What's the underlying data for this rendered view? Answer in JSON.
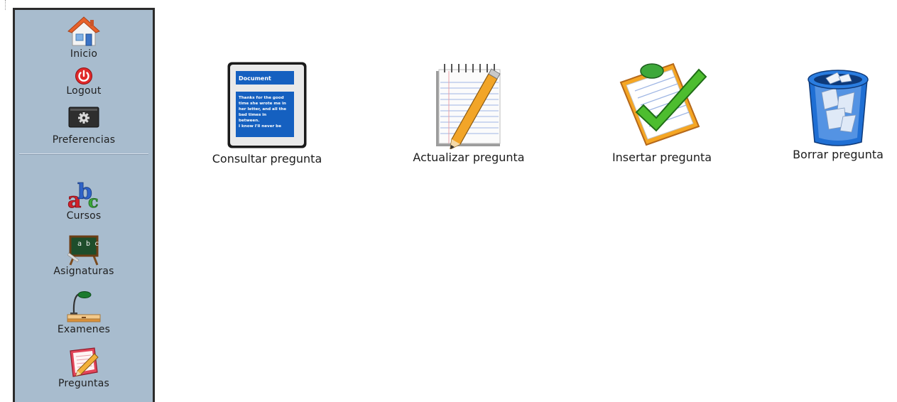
{
  "sidebar": {
    "top_items": [
      {
        "label": "Inicio",
        "icon": "home-icon"
      },
      {
        "label": "Logout",
        "icon": "power-icon"
      },
      {
        "label": "Preferencias",
        "icon": "gear-icon"
      }
    ],
    "items": [
      {
        "label": "Cursos",
        "icon": "abc-icon"
      },
      {
        "label": "Asignaturas",
        "icon": "chalkboard-icon"
      },
      {
        "label": "Examenes",
        "icon": "desk-lamp-icon"
      },
      {
        "label": "Preguntas",
        "icon": "notepad-pencil-icon"
      }
    ]
  },
  "actions": [
    {
      "label": "Consultar pregunta",
      "icon": "document-icon",
      "doc_title": "Document",
      "doc_lines": [
        "Thanks for the good",
        "time she wrote me in",
        "her letter, and all the",
        "bad times in",
        "between.",
        "I know I'll never be"
      ]
    },
    {
      "label": "Actualizar pregunta",
      "icon": "notepad-pencil-icon"
    },
    {
      "label": "Insertar pregunta",
      "icon": "clipboard-check-icon"
    },
    {
      "label": "Borrar pregunta",
      "icon": "trash-bin-icon"
    }
  ],
  "colors": {
    "sidebar_bg": "#a8bcce",
    "sidebar_border": "#2b2b2b",
    "document_blue": "#1560c0"
  }
}
